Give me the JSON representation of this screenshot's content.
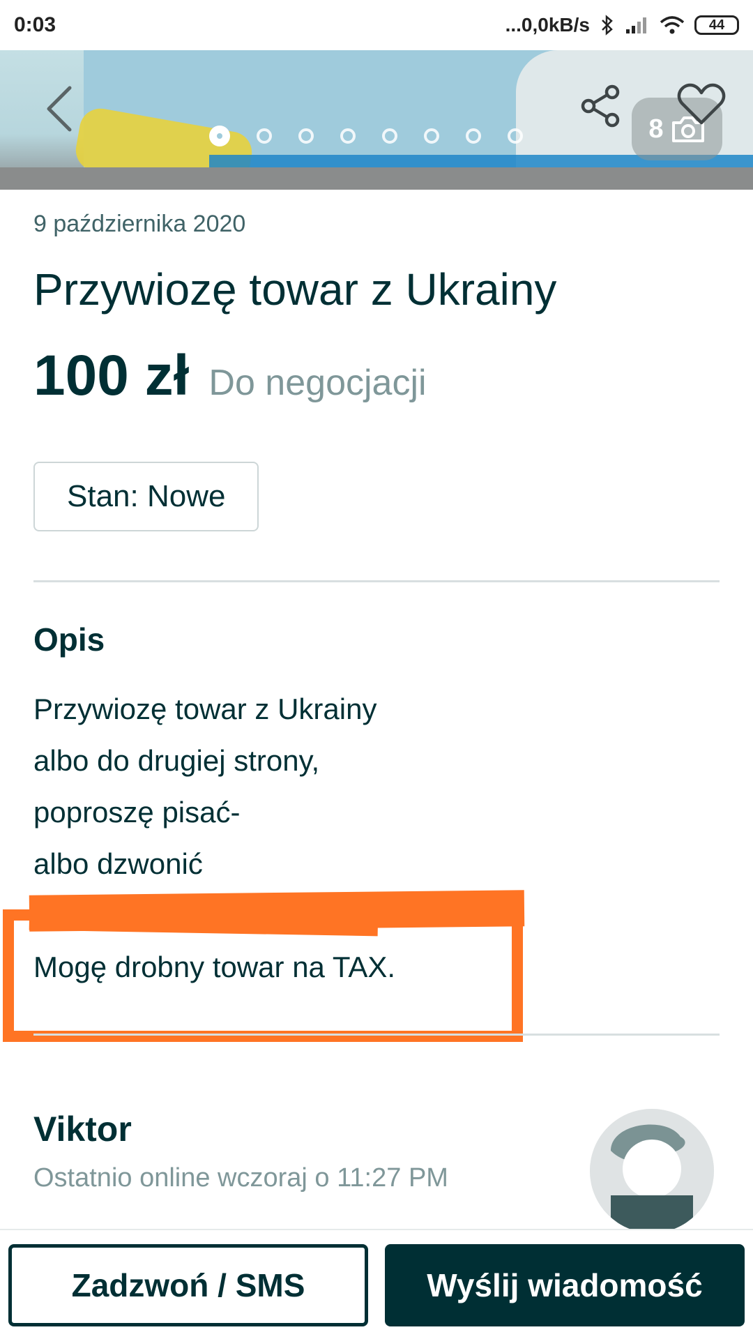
{
  "status_bar": {
    "time": "0:03",
    "network_speed": "...0,0kB/s",
    "battery": "44",
    "icons": [
      "bluetooth-icon",
      "signal-icon",
      "wifi-icon",
      "battery-icon"
    ]
  },
  "gallery": {
    "photo_count": "8",
    "total_dots": 8,
    "active_dot": 0,
    "icons": [
      "back-arrow-icon",
      "share-icon",
      "heart-icon",
      "camera-icon"
    ]
  },
  "listing": {
    "date": "9 października 2020",
    "title": "Przywiozę towar z Ukrainy",
    "price": "100 zł",
    "negotiable": "Do negocjacji",
    "condition_tag": "Stan: Nowe"
  },
  "description": {
    "heading": "Opis",
    "lines": [
      "Przywiozę towar z Ukrainy",
      "albo do drugiej strony,",
      "poproszę pisać-",
      "albo dzwonić",
      "",
      "Mogę drobny towar na TAX."
    ]
  },
  "seller": {
    "name": "Viktor",
    "last_online": "Ostatnio online wczoraj o 11:27 PM"
  },
  "actions": {
    "call_label": "Zadzwoń / SMS",
    "message_label": "Wyślij wiadomość"
  },
  "colors": {
    "primary": "#002f34",
    "muted": "#7f9799",
    "annotation": "#ff7424"
  }
}
